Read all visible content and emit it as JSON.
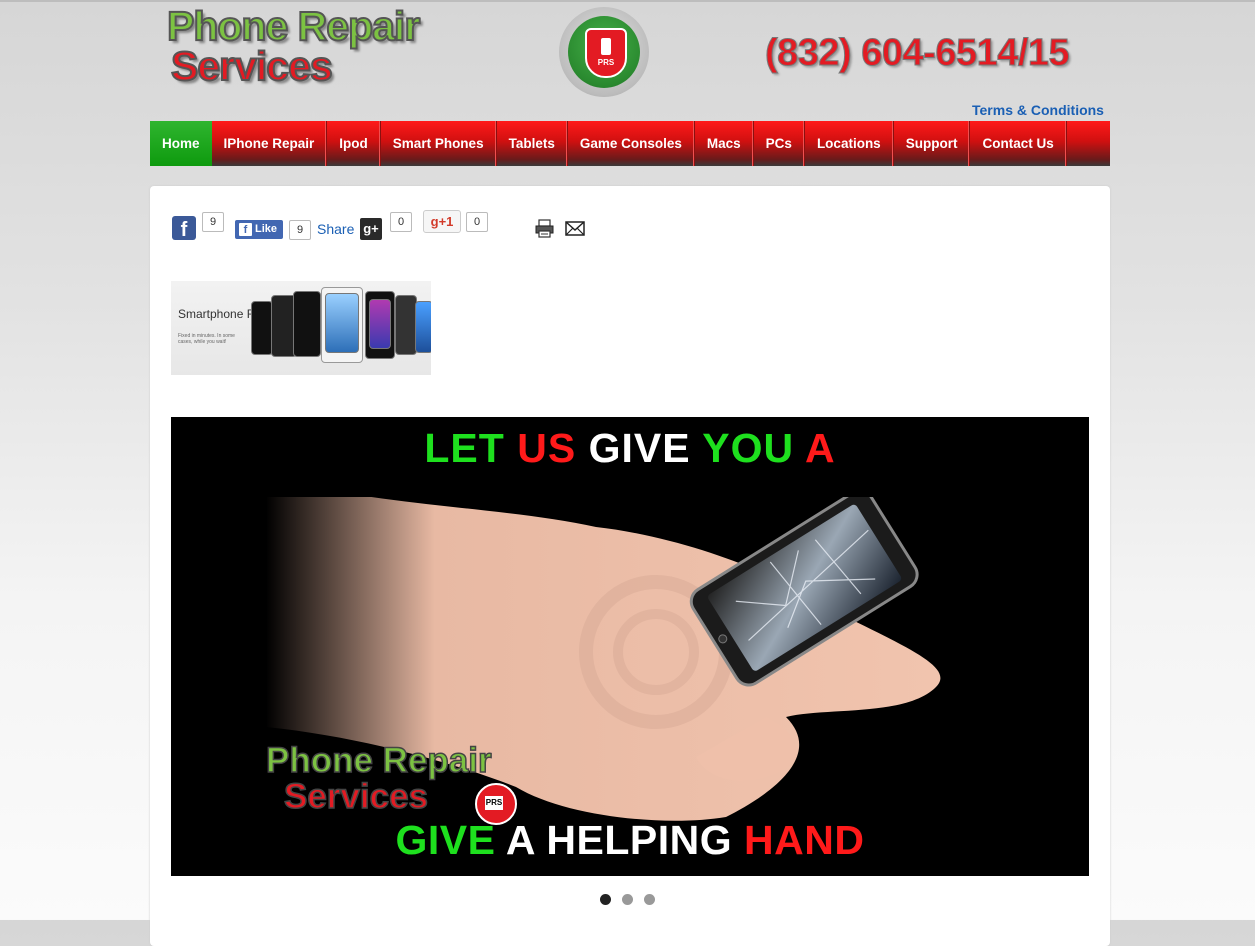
{
  "header": {
    "logo_line1": "Phone Repair",
    "logo_line2": "Services",
    "badge_text": "PRS",
    "phone": "(832) 604-6514/15",
    "terms_link": "Terms & Conditions"
  },
  "nav": {
    "items": [
      {
        "label": "Home",
        "active": true
      },
      {
        "label": "IPhone Repair"
      },
      {
        "label": "Ipod"
      },
      {
        "label": "Smart Phones"
      },
      {
        "label": "Tablets"
      },
      {
        "label": "Game Consoles"
      },
      {
        "label": "Macs"
      },
      {
        "label": "PCs"
      },
      {
        "label": "Locations"
      },
      {
        "label": "Support"
      },
      {
        "label": "Contact Us"
      }
    ]
  },
  "social": {
    "facebook_count": "9",
    "like_label": "Like",
    "like_count": "9",
    "share_label": "Share",
    "gplus_square_count": "0",
    "gplus_one_label": "+1",
    "gplus_one_count": "0"
  },
  "thumbnail": {
    "title": "Smartphone Repairs",
    "caption": "Fixed in minutes. In some cases, while you wait!"
  },
  "slider": {
    "top_words": [
      {
        "text": "LET",
        "color": "green"
      },
      {
        "text": "US",
        "color": "red"
      },
      {
        "text": "GIVE",
        "color": "white"
      },
      {
        "text": "YOU",
        "color": "green"
      },
      {
        "text": "A",
        "color": "red"
      }
    ],
    "logo_line1": "Phone Repair",
    "logo_line2": "Services",
    "badge_text": "PRS",
    "bottom_words": [
      {
        "text": "GIVE",
        "color": "green"
      },
      {
        "text": "A",
        "color": "white"
      },
      {
        "text": "HELPING",
        "color": "white"
      },
      {
        "text": "HAND",
        "color": "red"
      }
    ],
    "dots": {
      "count": 3,
      "active_index": 0
    }
  },
  "colors": {
    "brand_red": "#e31b23",
    "brand_green": "#7cc242",
    "nav_active": "#0e9a0e",
    "link_blue": "#1a5fb4"
  },
  "icons": {
    "print": "print-icon",
    "email": "email-icon"
  }
}
